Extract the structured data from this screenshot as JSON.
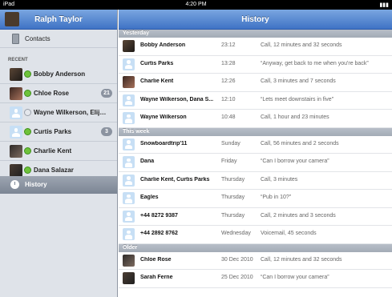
{
  "status_bar": {
    "device": "iPad",
    "time": "4:20 PM"
  },
  "sidebar": {
    "user_name": "Ralph Taylor",
    "contacts_label": "Contacts",
    "recent_label": "RECENT",
    "recent": [
      {
        "name": "Bobby Anderson",
        "status": "online",
        "badge": "",
        "avatar": "photo"
      },
      {
        "name": "Chloe Rose",
        "status": "online",
        "badge": "21",
        "avatar": "photo"
      },
      {
        "name": "Wayne Wilkerson, Elijah...",
        "status": "away",
        "badge": "",
        "avatar": "default"
      },
      {
        "name": "Curtis Parks",
        "status": "online",
        "badge": "3",
        "avatar": "default"
      },
      {
        "name": "Charlie Kent",
        "status": "online",
        "badge": "",
        "avatar": "photo"
      },
      {
        "name": "Dana Salazar",
        "status": "online",
        "badge": "",
        "avatar": "photo"
      }
    ],
    "history_label": "History"
  },
  "main": {
    "title": "History",
    "sections": [
      {
        "label": "Yesterday",
        "rows": [
          {
            "name": "Bobby Anderson",
            "time": "23:12",
            "detail": "Call, 12 minutes and 32 seconds",
            "avatar": "photo"
          },
          {
            "name": "Curtis Parks",
            "time": "13:28",
            "detail": "“Anyway, get back to me when you're back”",
            "avatar": "default"
          },
          {
            "name": "Charlie Kent",
            "time": "12:26",
            "detail": "Call, 3 minutes and 7 seconds",
            "avatar": "photo"
          },
          {
            "name": "Wayne Wilkerson, Dana S...",
            "time": "12:10",
            "detail": "“Lets meet downstairs in five”",
            "avatar": "default"
          },
          {
            "name": "Wayne Wilkerson",
            "time": "10:48",
            "detail": "Call, 1 hour and 23 minutes",
            "avatar": "default"
          }
        ]
      },
      {
        "label": "This week",
        "rows": [
          {
            "name": "Snowboardtrip'11",
            "time": "Sunday",
            "detail": "Call, 56 minutes and 2 seconds",
            "avatar": "default"
          },
          {
            "name": "Dana",
            "time": "Friday",
            "detail": "“Can I borrow your camera”",
            "avatar": "default"
          },
          {
            "name": "Charlie Kent, Curtis Parks",
            "time": "Thursday",
            "detail": "Call, 3 minutes",
            "avatar": "default"
          },
          {
            "name": "Eagles",
            "time": "Thursday",
            "detail": "“Pub in 10?”",
            "avatar": "default"
          },
          {
            "name": "+44 8272 9387",
            "time": "Thursday",
            "detail": "Call, 2 minutes and 3 seconds",
            "avatar": "default"
          },
          {
            "name": "+44 2892 8762",
            "time": "Wednesday",
            "detail": "Voicemail, 45 seconds",
            "avatar": "default"
          }
        ]
      },
      {
        "label": "Older",
        "rows": [
          {
            "name": "Chloe Rose",
            "time": "30 Dec 2010",
            "detail": "Call, 12 minutes and 32 seconds",
            "avatar": "photo"
          },
          {
            "name": "Sarah Ferne",
            "time": "25 Dec 2010",
            "detail": "“Can I borrow your camera”",
            "avatar": "photo"
          }
        ]
      }
    ]
  },
  "colors": {
    "header_blue": "#3f73c5",
    "sidebar_bg": "#dfe3e9",
    "online_green": "#6ec23a",
    "badge_gray": "#8b93a0",
    "section_gray": "#a3abb6"
  }
}
